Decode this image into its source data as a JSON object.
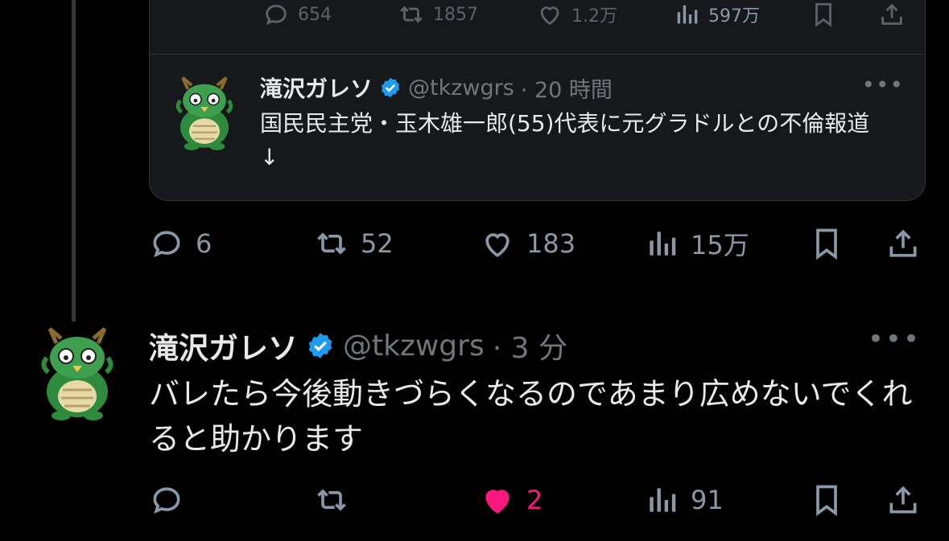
{
  "quote": {
    "metrics": {
      "replies": "654",
      "reposts": "1857",
      "likes": "1.2万",
      "views": "597万"
    },
    "author": {
      "name": "滝沢ガレソ",
      "handle": "@tkzwgrs",
      "time": "· 20 時間"
    },
    "more": "•••",
    "text": "国民民主党・玉木雄一郎(55)代表に元グラドルとの不倫報道\n↓"
  },
  "reply_metrics": {
    "replies": "6",
    "reposts": "52",
    "likes": "183",
    "views": "15万"
  },
  "tweet": {
    "author": {
      "name": "滝沢ガレソ",
      "handle": "@tkzwgrs",
      "time": "· 3 分"
    },
    "more": "•••",
    "text": "バレたら今後動きづらくなるのであまり広めないでくれると助かります",
    "metrics": {
      "replies": "",
      "reposts": "",
      "likes": "2",
      "views": "91"
    }
  },
  "colors": {
    "background": "#000000",
    "text": "#e7e9ea",
    "muted": "#71767b",
    "verified": "#1d9bf0",
    "like_active": "#f91880",
    "card": "#16181c"
  },
  "icons": [
    "reply-icon",
    "repost-icon",
    "like-icon",
    "views-icon",
    "bookmark-icon",
    "share-icon",
    "verified-badge-icon"
  ]
}
